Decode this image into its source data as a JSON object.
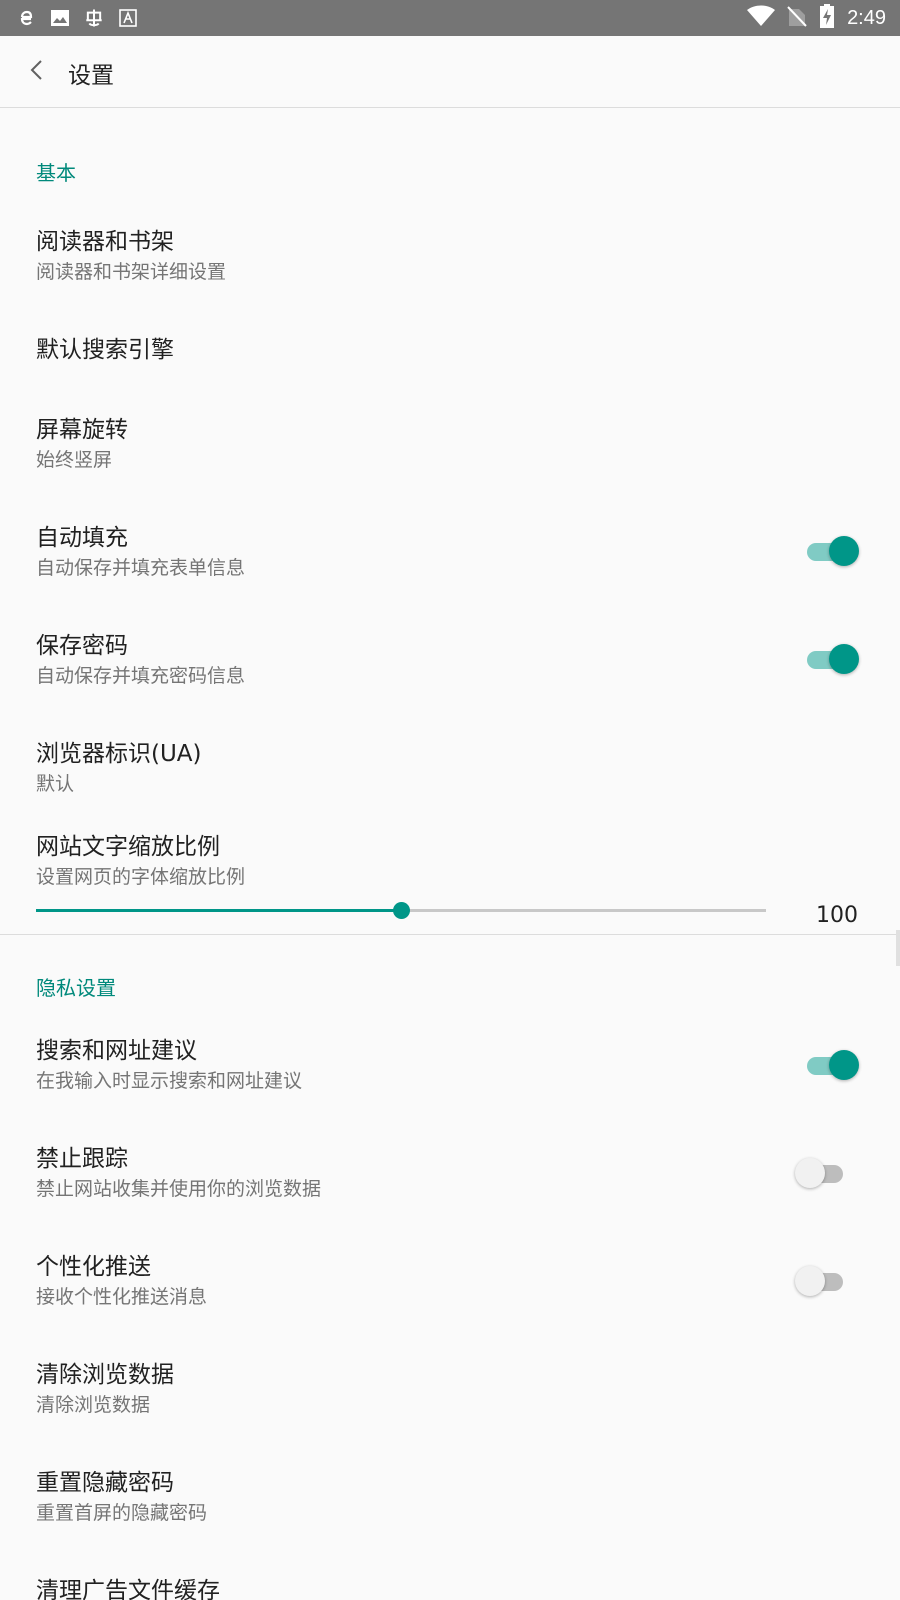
{
  "status_bar": {
    "time": "2:49",
    "left_icons": [
      "browser-icon",
      "image-icon",
      "bug-icon",
      "font-icon"
    ],
    "right_icons": [
      "wifi-icon",
      "no-sim-icon",
      "battery-charging-icon"
    ]
  },
  "app_bar": {
    "title": "设置",
    "back_icon": "back-arrow-icon"
  },
  "sections": {
    "basic": {
      "header": "基本"
    },
    "privacy": {
      "header": "隐私设置"
    }
  },
  "items": {
    "reader_shelf": {
      "title": "阅读器和书架",
      "subtitle": "阅读器和书架详细设置"
    },
    "default_search": {
      "title": "默认搜索引擎"
    },
    "screen_rotation": {
      "title": "屏幕旋转",
      "subtitle": "始终竖屏"
    },
    "autofill": {
      "title": "自动填充",
      "subtitle": "自动保存并填充表单信息",
      "enabled": true
    },
    "save_password": {
      "title": "保存密码",
      "subtitle": "自动保存并填充密码信息",
      "enabled": true
    },
    "user_agent": {
      "title": "浏览器标识(UA)",
      "subtitle": "默认"
    },
    "text_scale": {
      "title": "网站文字缩放比例",
      "subtitle": "设置网页的字体缩放比例",
      "value": "100",
      "slider_fraction": 0.5
    },
    "search_suggest": {
      "title": "搜索和网址建议",
      "subtitle": "在我输入时显示搜索和网址建议",
      "enabled": true
    },
    "do_not_track": {
      "title": "禁止跟踪",
      "subtitle": "禁止网站收集并使用你的浏览数据",
      "enabled": false
    },
    "personalized_push": {
      "title": "个性化推送",
      "subtitle": "接收个性化推送消息",
      "enabled": false
    },
    "clear_data": {
      "title": "清除浏览数据",
      "subtitle": "清除浏览数据"
    },
    "reset_hidden_pwd": {
      "title": "重置隐藏密码",
      "subtitle": "重置首屏的隐藏密码"
    },
    "clear_ad_cache": {
      "title": "清理广告文件缓存"
    }
  },
  "colors": {
    "accent": "#009688",
    "accent_light": "#80cbc4",
    "status_bar": "#757575",
    "text_primary": "#212121",
    "text_secondary": "#757575"
  }
}
